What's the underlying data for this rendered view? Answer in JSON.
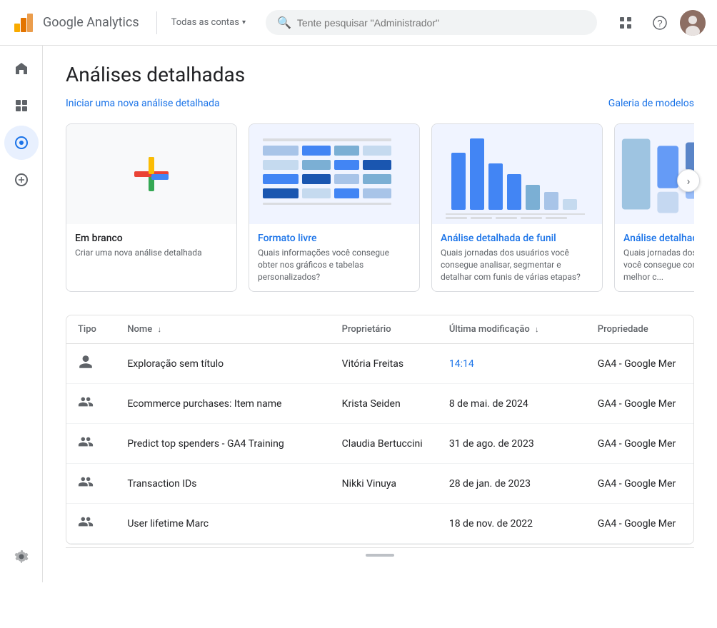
{
  "app": {
    "title": "Google Analytics",
    "account_selector": "Todas as contas",
    "search_placeholder": "Tente pesquisar \"Administrador\""
  },
  "sidebar": {
    "items": [
      {
        "id": "home",
        "icon": "⌂",
        "label": "Home"
      },
      {
        "id": "reports",
        "icon": "▦",
        "label": "Reports"
      },
      {
        "id": "explore",
        "icon": "◎",
        "label": "Explore",
        "active": true
      },
      {
        "id": "advertising",
        "icon": "◉",
        "label": "Advertising"
      }
    ],
    "bottom_item": {
      "id": "settings",
      "icon": "⚙",
      "label": "Settings"
    }
  },
  "page": {
    "title": "Análises detalhadas",
    "new_analysis_label": "Iniciar uma nova análise detalhada",
    "gallery_label": "Galeria de modelos"
  },
  "templates": [
    {
      "id": "blank",
      "title": "Em branco",
      "subtitle": "Criar uma nova análise detalhada",
      "type": "blank"
    },
    {
      "id": "formato-livre",
      "title": "Formato livre",
      "title_color": "#1a73e8",
      "subtitle": "Quais informações você consegue obter nos gráficos e tabelas personalizados?",
      "type": "heatmap"
    },
    {
      "id": "funil",
      "title": "Análise detalhada de funil",
      "title_color": "#1a73e8",
      "subtitle": "Quais jornadas dos usuários você consegue analisar, segmentar e detalhar com funis de várias etapas?",
      "type": "funnel"
    },
    {
      "id": "caminho",
      "title": "Análise detalhada de",
      "title_color": "#1a73e8",
      "subtitle": "Quais jornadas dos usuários você consegue compreender melhor c...",
      "type": "path"
    }
  ],
  "table": {
    "headers": [
      {
        "id": "tipo",
        "label": "Tipo"
      },
      {
        "id": "nome",
        "label": "Nome",
        "sortable": true
      },
      {
        "id": "proprietario",
        "label": "Proprietário"
      },
      {
        "id": "modificacao",
        "label": "Última modificação",
        "sortable": true
      },
      {
        "id": "propriedade",
        "label": "Propriedade"
      }
    ],
    "rows": [
      {
        "tipo_icon": "person",
        "nome": "Exploração sem título",
        "proprietario": "Vitória Freitas",
        "modificacao": "14:14",
        "modificacao_blue": true,
        "propriedade": "GA4 - Google Mer"
      },
      {
        "tipo_icon": "people",
        "nome": "Ecommerce purchases: Item name",
        "proprietario": "Krista Seiden",
        "modificacao": "8 de mai. de 2024",
        "modificacao_blue": false,
        "propriedade": "GA4 - Google Mer"
      },
      {
        "tipo_icon": "people",
        "nome": "Predict top spenders - GA4 Training",
        "proprietario": "Claudia Bertuccini",
        "modificacao": "31 de ago. de 2023",
        "modificacao_blue": false,
        "propriedade": "GA4 - Google Mer"
      },
      {
        "tipo_icon": "people",
        "nome": "Transaction IDs",
        "proprietario": "Nikki Vinuya",
        "modificacao": "28 de jan. de 2023",
        "modificacao_blue": false,
        "propriedade": "GA4 - Google Mer"
      },
      {
        "tipo_icon": "people",
        "nome": "User lifetime Marc",
        "proprietario": "",
        "modificacao": "18 de nov. de 2022",
        "modificacao_blue": false,
        "propriedade": "GA4 - Google Mer"
      }
    ]
  }
}
